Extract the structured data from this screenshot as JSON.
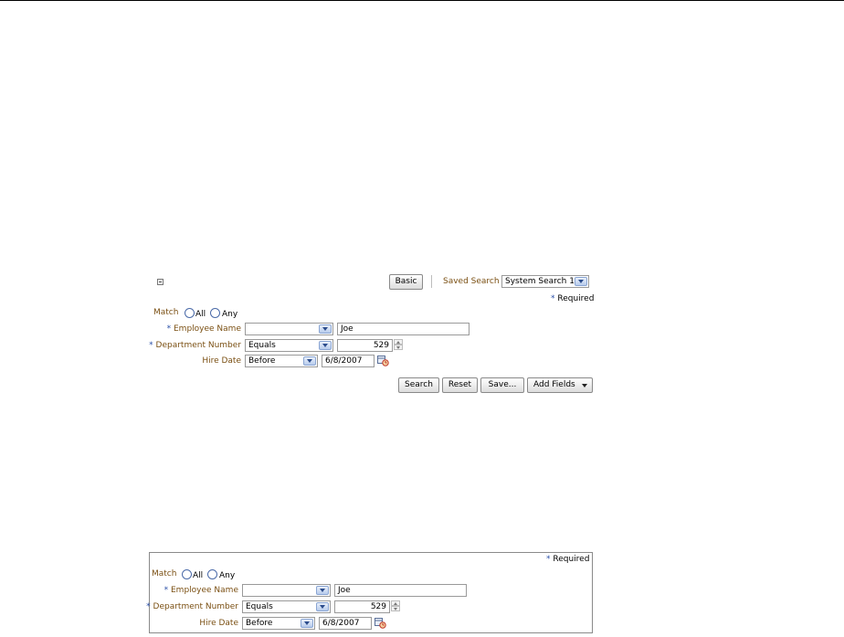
{
  "panel1": {
    "basic_label": "Basic",
    "saved_search_label": "Saved Search",
    "saved_search_value": "System Search 1",
    "required_star": "*",
    "required_label": "Required",
    "match_label": "Match",
    "match_all": "All",
    "match_any": "Any",
    "employee_name_label": "Employee Name",
    "employee_name_value": "Joe",
    "department_number_label": "Department Number",
    "department_operator": "Equals",
    "department_value": "529",
    "hire_date_label": "Hire Date",
    "hire_date_operator": "Before",
    "hire_date_value": "6/8/2007",
    "search_label": "Search",
    "reset_label": "Reset",
    "save_label": "Save...",
    "add_fields_label": "Add Fields"
  },
  "panel2": {
    "required_star": "*",
    "required_label": "Required",
    "match_label": "Match",
    "match_all": "All",
    "match_any": "Any",
    "employee_name_label": "Employee Name",
    "employee_name_value": "Joe",
    "department_number_label": "Department Number",
    "department_operator": "Equals",
    "department_value": "529",
    "hire_date_label": "Hire Date",
    "hire_date_operator": "Before",
    "hire_date_value": "6/8/2007"
  },
  "icons": {
    "collapse": "collapse-icon",
    "dropdown": "chevron-down-icon",
    "calendar": "calendar-icon",
    "spinner": "spinner-icon"
  }
}
